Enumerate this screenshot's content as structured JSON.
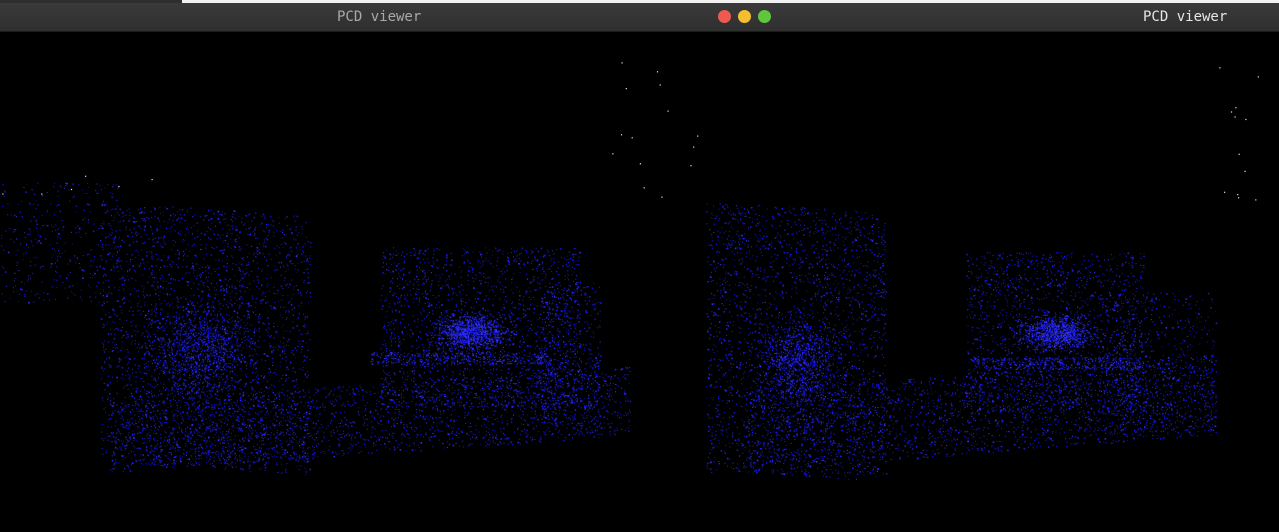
{
  "windows": [
    {
      "title": "PCD viewer",
      "focused": false
    },
    {
      "title": "PCD viewer",
      "focused": true
    }
  ],
  "window_controls": {
    "close": "close-icon",
    "minimize": "minimize-icon",
    "zoom": "zoom-icon"
  },
  "colors": {
    "background": "#000000",
    "titlebar": "#333333",
    "points": "#1a1aff",
    "highlight_points": "#3333ff",
    "stray_points": "#ffffff",
    "close": "#ee5a52",
    "minimize": "#f5bd30",
    "zoom": "#5fc73d"
  }
}
